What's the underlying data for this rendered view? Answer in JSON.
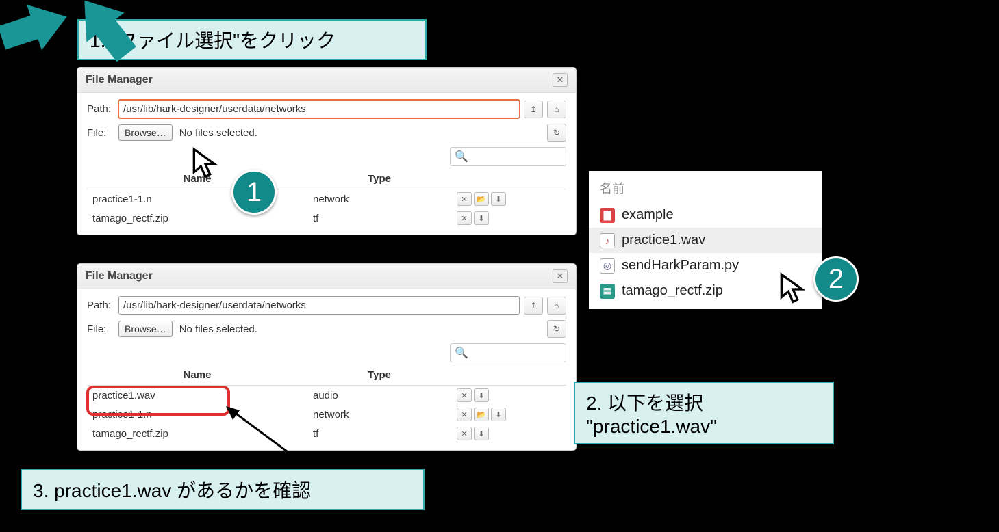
{
  "callouts": {
    "c1": "1. \"ファイル選択\"をクリック",
    "c2_line1": "2. 以下を選択",
    "c2_line2": "\"practice1.wav\"",
    "c3": "3. practice1.wav があるかを確認"
  },
  "dialog": {
    "title": "File Manager",
    "path_label": "Path:",
    "path_value": "/usr/lib/hark-designer/userdata/networks",
    "file_label": "File:",
    "browse_label": "Browse…",
    "no_files": "No files selected.",
    "cols": {
      "name": "Name",
      "type": "Type"
    }
  },
  "table1": [
    {
      "name": "practice1-1.n",
      "type": "network",
      "actions": [
        "del",
        "open",
        "down"
      ]
    },
    {
      "name": "tamago_rectf.zip",
      "type": "tf",
      "actions": [
        "del",
        "down"
      ]
    }
  ],
  "table2": [
    {
      "name": "practice1.wav",
      "type": "audio",
      "actions": [
        "del",
        "down"
      ]
    },
    {
      "name": "practice1-1.n",
      "type": "network",
      "actions": [
        "del",
        "open",
        "down"
      ]
    },
    {
      "name": "tamago_rectf.zip",
      "type": "tf",
      "actions": [
        "del",
        "down"
      ]
    }
  ],
  "picker": {
    "header": "名前",
    "items": [
      {
        "icon": "folder",
        "label": "example"
      },
      {
        "icon": "audio",
        "label": "practice1.wav",
        "selected": true
      },
      {
        "icon": "py",
        "label": "sendHarkParam.py"
      },
      {
        "icon": "zip",
        "label": "tamago_rectf.zip"
      }
    ]
  },
  "badges": {
    "b1": "1",
    "b2": "2"
  }
}
